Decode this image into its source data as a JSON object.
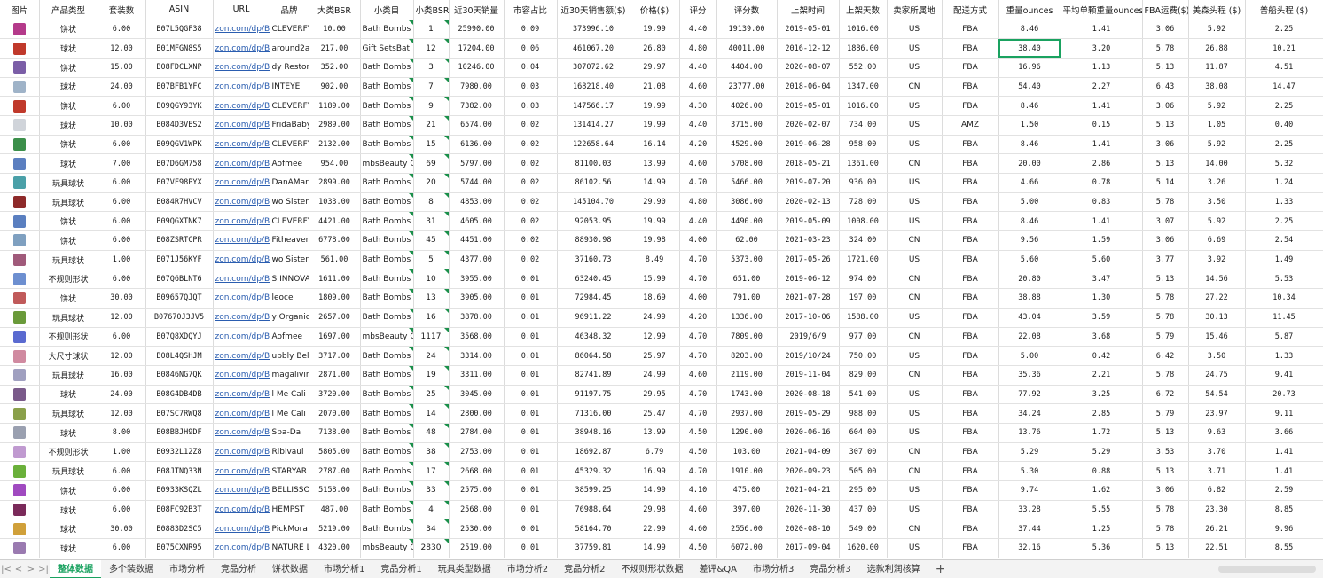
{
  "sheet": {
    "columns": [
      "图片",
      "产品类型",
      "套装数",
      "ASIN",
      "URL",
      "品牌",
      "大类BSR",
      "小类目",
      "小类BSR",
      "近30天销量",
      "市容占比",
      "近30天销售额($)",
      "价格($)",
      "评分",
      "评分数",
      "上架时间",
      "上架天数",
      "卖家所属地",
      "配送方式",
      "重量ounces",
      "平均单颗重量ounces",
      "FBA运费($)",
      "美森头程 ($)",
      "普船头程 ($)"
    ],
    "rows": [
      [
        "",
        "饼状",
        "6.00",
        "B07L5QGF38",
        "zon.com/dp/B",
        "CLEVERFY",
        "10.00",
        "Bath Bombs",
        "1",
        "25990.00",
        "0.09",
        "373996.10",
        "19.99",
        "4.40",
        "19139.00",
        "2019-05-01",
        "1016.00",
        "US",
        "FBA",
        "8.46",
        "1.41",
        "3.06",
        "5.92",
        "2.25"
      ],
      [
        "",
        "球状",
        "12.00",
        "B01MFGN8S5",
        "zon.com/dp/B",
        "around2an",
        "217.00",
        "Gift SetsBat",
        "12",
        "17204.00",
        "0.06",
        "461067.20",
        "26.80",
        "4.80",
        "40011.00",
        "2016-12-12",
        "1886.00",
        "US",
        "FBA",
        "38.40",
        "3.20",
        "5.78",
        "26.88",
        "10.21"
      ],
      [
        "",
        "饼状",
        "15.00",
        "B08FDCLXNP",
        "zon.com/dp/B",
        "dy Restor",
        "352.00",
        "Bath Bombs",
        "3",
        "10246.00",
        "0.04",
        "307072.62",
        "29.97",
        "4.40",
        "4404.00",
        "2020-08-07",
        "552.00",
        "US",
        "FBA",
        "16.96",
        "1.13",
        "5.13",
        "11.87",
        "4.51"
      ],
      [
        "",
        "球状",
        "24.00",
        "B07BFB1YFC",
        "zon.com/dp/B",
        "INTEYE",
        "902.00",
        "Bath Bombs",
        "7",
        "7980.00",
        "0.03",
        "168218.40",
        "21.08",
        "4.60",
        "23777.00",
        "2018-06-04",
        "1347.00",
        "CN",
        "FBA",
        "54.40",
        "2.27",
        "6.43",
        "38.08",
        "14.47"
      ],
      [
        "",
        "饼状",
        "6.00",
        "B09QGY93YK",
        "zon.com/dp/B",
        "CLEVERFY",
        "1189.00",
        "Bath Bombs",
        "9",
        "7382.00",
        "0.03",
        "147566.17",
        "19.99",
        "4.30",
        "4026.00",
        "2019-05-01",
        "1016.00",
        "US",
        "FBA",
        "8.46",
        "1.41",
        "3.06",
        "5.92",
        "2.25"
      ],
      [
        "",
        "球状",
        "10.00",
        "B084D3VES2",
        "zon.com/dp/B",
        "FridaBaby",
        "2989.00",
        "Bath Bombs",
        "21",
        "6574.00",
        "0.02",
        "131414.27",
        "19.99",
        "4.40",
        "3715.00",
        "2020-02-07",
        "734.00",
        "US",
        "AMZ",
        "1.50",
        "0.15",
        "5.13",
        "1.05",
        "0.40"
      ],
      [
        "",
        "饼状",
        "6.00",
        "B09QGV1WPK",
        "zon.com/dp/B",
        "CLEVERFY",
        "2132.00",
        "Bath Bombs",
        "15",
        "6136.00",
        "0.02",
        "122658.64",
        "16.14",
        "4.20",
        "4529.00",
        "2019-06-28",
        "958.00",
        "US",
        "FBA",
        "8.46",
        "1.41",
        "3.06",
        "5.92",
        "2.25"
      ],
      [
        "",
        "球状",
        "7.00",
        "B07D6GM758",
        "zon.com/dp/B",
        "Aofmee",
        "954.00",
        "mbsBeauty Gi",
        "69",
        "5797.00",
        "0.02",
        "81100.03",
        "13.99",
        "4.60",
        "5708.00",
        "2018-05-21",
        "1361.00",
        "CN",
        "FBA",
        "20.00",
        "2.86",
        "5.13",
        "14.00",
        "5.32"
      ],
      [
        "",
        "玩具球状",
        "6.00",
        "B07VF98PYX",
        "zon.com/dp/B",
        "DanAMarci",
        "2899.00",
        "Bath Bombs",
        "20",
        "5744.00",
        "0.02",
        "86102.56",
        "14.99",
        "4.70",
        "5466.00",
        "2019-07-20",
        "936.00",
        "US",
        "FBA",
        "4.66",
        "0.78",
        "5.14",
        "3.26",
        "1.24"
      ],
      [
        "",
        "玩具球状",
        "6.00",
        "B084R7HVCV",
        "zon.com/dp/B",
        "wo Sister",
        "1033.00",
        "Bath Bombs",
        "8",
        "4853.00",
        "0.02",
        "145104.70",
        "29.90",
        "4.80",
        "3086.00",
        "2020-02-13",
        "728.00",
        "US",
        "FBA",
        "5.00",
        "0.83",
        "5.78",
        "3.50",
        "1.33"
      ],
      [
        "",
        "饼状",
        "6.00",
        "B09QGXTNK7",
        "zon.com/dp/B",
        "CLEVERFY",
        "4421.00",
        "Bath Bombs",
        "31",
        "4605.00",
        "0.02",
        "92053.95",
        "19.99",
        "4.40",
        "4490.00",
        "2019-05-09",
        "1008.00",
        "US",
        "FBA",
        "8.46",
        "1.41",
        "3.07",
        "5.92",
        "2.25"
      ],
      [
        "",
        "饼状",
        "6.00",
        "B08ZSRTCPR",
        "zon.com/dp/B",
        "Fitheaven",
        "6778.00",
        "Bath Bombs",
        "45",
        "4451.00",
        "0.02",
        "88930.98",
        "19.98",
        "4.00",
        "62.00",
        "2021-03-23",
        "324.00",
        "CN",
        "FBA",
        "9.56",
        "1.59",
        "3.06",
        "6.69",
        "2.54"
      ],
      [
        "",
        "玩具球状",
        "1.00",
        "B071J56KYF",
        "zon.com/dp/B",
        "wo Sister",
        "561.00",
        "Bath Bombs",
        "5",
        "4377.00",
        "0.02",
        "37160.73",
        "8.49",
        "4.70",
        "5373.00",
        "2017-05-26",
        "1721.00",
        "US",
        "FBA",
        "5.60",
        "5.60",
        "3.77",
        "3.92",
        "1.49"
      ],
      [
        "",
        "不规则形状",
        "6.00",
        "B07Q6BLNT6",
        "zon.com/dp/B",
        "S INNOVAT",
        "1611.00",
        "Bath Bombs",
        "10",
        "3955.00",
        "0.01",
        "63240.45",
        "15.99",
        "4.70",
        "651.00",
        "2019-06-12",
        "974.00",
        "CN",
        "FBA",
        "20.80",
        "3.47",
        "5.13",
        "14.56",
        "5.53"
      ],
      [
        "",
        "饼状",
        "30.00",
        "B09657QJQT",
        "zon.com/dp/B",
        "leoce",
        "1809.00",
        "Bath Bombs",
        "13",
        "3905.00",
        "0.01",
        "72984.45",
        "18.69",
        "4.00",
        "791.00",
        "2021-07-28",
        "197.00",
        "CN",
        "FBA",
        "38.88",
        "1.30",
        "5.78",
        "27.22",
        "10.34"
      ],
      [
        "",
        "玩具球状",
        "12.00",
        "B07670J3JV5",
        "zon.com/dp/B",
        "y Organic",
        "2657.00",
        "Bath Bombs",
        "16",
        "3878.00",
        "0.01",
        "96911.22",
        "24.99",
        "4.20",
        "1336.00",
        "2017-10-06",
        "1588.00",
        "US",
        "FBA",
        "43.04",
        "3.59",
        "5.78",
        "30.13",
        "11.45"
      ],
      [
        "",
        "不规则形状",
        "6.00",
        "B07Q8XDQYJ",
        "zon.com/dp/B",
        "Aofmee",
        "1697.00",
        "mbsBeauty Gi",
        "1117",
        "3568.00",
        "0.01",
        "46348.32",
        "12.99",
        "4.70",
        "7809.00",
        "2019/6/9",
        "977.00",
        "CN",
        "FBA",
        "22.08",
        "3.68",
        "5.79",
        "15.46",
        "5.87"
      ],
      [
        "",
        "大尺寸球状",
        "12.00",
        "B08L4QSHJM",
        "zon.com/dp/B",
        "ubbly Bel",
        "3717.00",
        "Bath Bombs",
        "24",
        "3314.00",
        "0.01",
        "86064.58",
        "25.97",
        "4.70",
        "8203.00",
        "2019/10/24",
        "750.00",
        "US",
        "FBA",
        "5.00",
        "0.42",
        "6.42",
        "3.50",
        "1.33"
      ],
      [
        "",
        "玩具球状",
        "16.00",
        "B0846NG7QK",
        "zon.com/dp/B",
        "magalivin",
        "2871.00",
        "Bath Bombs",
        "19",
        "3311.00",
        "0.01",
        "82741.89",
        "24.99",
        "4.60",
        "2119.00",
        "2019-11-04",
        "829.00",
        "CN",
        "FBA",
        "35.36",
        "2.21",
        "5.78",
        "24.75",
        "9.41"
      ],
      [
        "",
        "球状",
        "24.00",
        "B08G4DB4DB",
        "zon.com/dp/B",
        "l Me Cali",
        "3720.00",
        "Bath Bombs",
        "25",
        "3045.00",
        "0.01",
        "91197.75",
        "29.95",
        "4.70",
        "1743.00",
        "2020-08-18",
        "541.00",
        "US",
        "FBA",
        "77.92",
        "3.25",
        "6.72",
        "54.54",
        "20.73"
      ],
      [
        "",
        "玩具球状",
        "12.00",
        "B07SC7RWQ8",
        "zon.com/dp/B",
        "l Me Cali",
        "2070.00",
        "Bath Bombs",
        "14",
        "2800.00",
        "0.01",
        "71316.00",
        "25.47",
        "4.70",
        "2937.00",
        "2019-05-29",
        "988.00",
        "US",
        "FBA",
        "34.24",
        "2.85",
        "5.79",
        "23.97",
        "9.11"
      ],
      [
        "",
        "球状",
        "8.00",
        "B08BBJH9DF",
        "zon.com/dp/B",
        "Spa-Da",
        "7138.00",
        "Bath Bombs",
        "48",
        "2784.00",
        "0.01",
        "38948.16",
        "13.99",
        "4.50",
        "1290.00",
        "2020-06-16",
        "604.00",
        "US",
        "FBA",
        "13.76",
        "1.72",
        "5.13",
        "9.63",
        "3.66"
      ],
      [
        "",
        "不规则形状",
        "1.00",
        "B0932L12Z8",
        "zon.com/dp/B",
        "Ribivaul",
        "5805.00",
        "Bath Bombs",
        "38",
        "2753.00",
        "0.01",
        "18692.87",
        "6.79",
        "4.50",
        "103.00",
        "2021-04-09",
        "307.00",
        "CN",
        "FBA",
        "5.29",
        "5.29",
        "3.53",
        "3.70",
        "1.41"
      ],
      [
        "",
        "玩具球状",
        "6.00",
        "B08JTNQ33N",
        "zon.com/dp/B",
        "STARYAR",
        "2787.00",
        "Bath Bombs",
        "17",
        "2668.00",
        "0.01",
        "45329.32",
        "16.99",
        "4.70",
        "1910.00",
        "2020-09-23",
        "505.00",
        "CN",
        "FBA",
        "5.30",
        "0.88",
        "5.13",
        "3.71",
        "1.41"
      ],
      [
        "",
        "饼状",
        "6.00",
        "B0933KSQZL",
        "zon.com/dp/B",
        "BELLISSO",
        "5158.00",
        "Bath Bombs",
        "33",
        "2575.00",
        "0.01",
        "38599.25",
        "14.99",
        "4.10",
        "475.00",
        "2021-04-21",
        "295.00",
        "US",
        "FBA",
        "9.74",
        "1.62",
        "3.06",
        "6.82",
        "2.59"
      ],
      [
        "",
        "球状",
        "6.00",
        "B08FC92B3T",
        "zon.com/dp/B",
        "HEMPST",
        "487.00",
        "Bath Bombs",
        "4",
        "2568.00",
        "0.01",
        "76988.64",
        "29.98",
        "4.60",
        "397.00",
        "2020-11-30",
        "437.00",
        "US",
        "FBA",
        "33.28",
        "5.55",
        "5.78",
        "23.30",
        "8.85"
      ],
      [
        "",
        "球状",
        "30.00",
        "B0883D2SC5",
        "zon.com/dp/B",
        "PickMora",
        "5219.00",
        "Bath Bombs",
        "34",
        "2530.00",
        "0.01",
        "58164.70",
        "22.99",
        "4.60",
        "2556.00",
        "2020-08-10",
        "549.00",
        "CN",
        "FBA",
        "37.44",
        "1.25",
        "5.78",
        "26.21",
        "9.96"
      ],
      [
        "",
        "球状",
        "6.00",
        "B075CXNR95",
        "zon.com/dp/B",
        "NATURE LU",
        "4320.00",
        "mbsBeauty Gi",
        "2830",
        "2519.00",
        "0.01",
        "37759.81",
        "14.99",
        "4.50",
        "6072.00",
        "2017-09-04",
        "1620.00",
        "US",
        "FBA",
        "32.16",
        "5.36",
        "5.13",
        "22.51",
        "8.55"
      ]
    ],
    "thumb_colors": [
      "#b43a8a",
      "#c0392b",
      "#7b5ea7",
      "#9fb3c8",
      "#c0392b",
      "#d0d4da",
      "#3b8f4a",
      "#5b7fc0",
      "#4aa0a8",
      "#8e2a2a",
      "#5a7fc0",
      "#7fa0c0",
      "#a05a7a",
      "#6d8fd0",
      "#c05a5a",
      "#6a9a3a",
      "#5a6ad0",
      "#d08aa0",
      "#a0a0c0",
      "#7a5a8a",
      "#8aa04a",
      "#9aa0b0",
      "#c09ad0",
      "#6ab03a",
      "#a04ac0",
      "#7a2a5a",
      "#d0a03a",
      "#9a7ab0"
    ]
  },
  "tabs": {
    "items": [
      "整体数据",
      "多个装数据",
      "市场分析",
      "竞品分析",
      "饼状数据",
      "市场分析1",
      "竞品分析1",
      "玩具类型数据",
      "市场分析2",
      "竞品分析2",
      "不规则形状数据",
      "差评&QA",
      "市场分析3",
      "竞品分析3",
      "选款利润核算"
    ]
  }
}
